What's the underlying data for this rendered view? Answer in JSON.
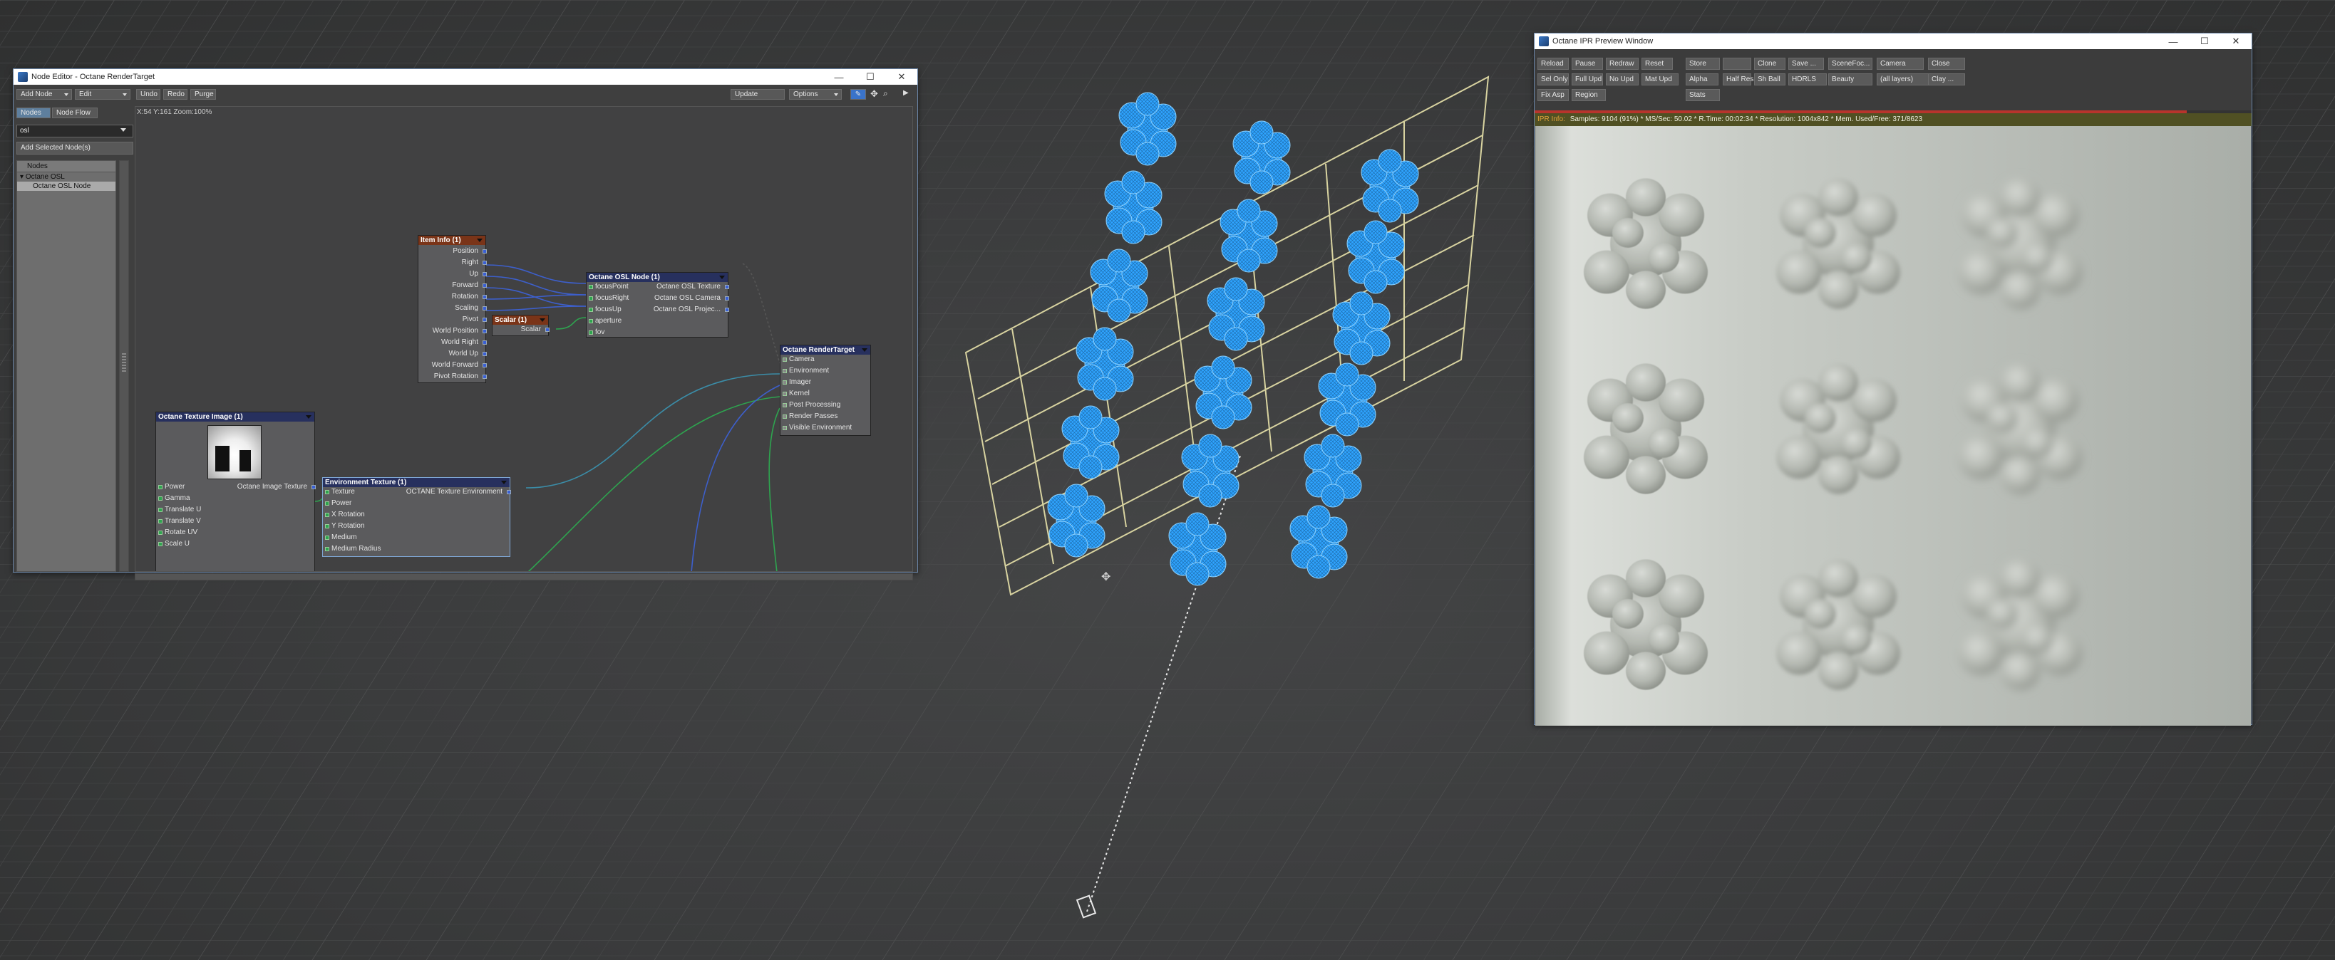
{
  "node_editor": {
    "title": "Node Editor - Octane RenderTarget",
    "toolbar": {
      "add_node": "Add Node",
      "edit": "Edit",
      "undo": "Undo",
      "redo": "Redo",
      "purge": "Purge",
      "update": "Update",
      "options": "Options"
    },
    "tabs": [
      "Nodes",
      "Node Flow"
    ],
    "search_value": "osl",
    "add_selected": "Add Selected Node(s)",
    "coords": "X:54 Y:161 Zoom:100%",
    "tree": {
      "header": "Nodes",
      "group": "Octane OSL",
      "item": "Octane OSL Node"
    },
    "nodes": {
      "item_info": {
        "title": "Item Info (1)",
        "outputs": [
          "Position",
          "Right",
          "Up",
          "Forward",
          "Rotation",
          "Scaling",
          "Pivot",
          "World Position",
          "World Right",
          "World Up",
          "World Forward",
          "Pivot Rotation"
        ]
      },
      "scalar": {
        "title": "Scalar (1)",
        "output": "Scalar"
      },
      "osl": {
        "title": "Octane OSL Node (1)",
        "inputs": [
          "focusPoint",
          "focusRight",
          "focusUp",
          "aperture",
          "fov"
        ],
        "outputs": [
          "Octane OSL Texture",
          "Octane OSL Camera",
          "Octane OSL Projec..."
        ]
      },
      "render_target": {
        "title": "Octane RenderTarget",
        "inputs": [
          "Camera",
          "Environment",
          "Imager",
          "Kernel",
          "Post Processing",
          "Render Passes",
          "Visible Environment"
        ]
      },
      "texture_image": {
        "title": "Octane Texture Image (1)",
        "inputs": [
          "Power",
          "Gamma",
          "Translate U",
          "Translate V",
          "Rotate UV",
          "Scale U"
        ],
        "output": "Octane Image Texture"
      },
      "env_texture": {
        "title": "Environment Texture (1)",
        "inputs": [
          "Texture",
          "Power",
          "X Rotation",
          "Y Rotation",
          "Medium",
          "Medium Radius"
        ],
        "output": "OCTANE Texture Environment"
      }
    }
  },
  "ipr": {
    "title": "Octane IPR Preview Window",
    "row1": [
      "Reload",
      "Pause",
      "Redraw",
      "Reset",
      "Store",
      "",
      "Clone",
      "Save ...",
      "SceneFoc...",
      "Camera",
      "Close"
    ],
    "row2": [
      "Sel Only",
      "Full Upd",
      "No Upd",
      "Mat Upd",
      "Alpha",
      "Half Res",
      "Sh Ball",
      "HDRLS",
      "Beauty",
      "(all layers)",
      "Clay ..."
    ],
    "row3": [
      "Fix Asp",
      "Region",
      "Stats"
    ],
    "info_label": "IPR Info:",
    "info_text": "Samples: 9104 (91%)  *  MS/Sec: 50.02  *  R.Time: 00:02:34  *  Resolution: 1004x842  *  Mem. Used/Free: 371/8623"
  },
  "colors": {
    "viewport_bg": "#3b3c3d",
    "mesh_blue": "#2fa4ff",
    "cage_line": "#d8d3a0",
    "item_info_header": "#7a3418",
    "scalar_header": "#7a3418",
    "blue_header": "#27305e",
    "titlebar": "#ffffff"
  }
}
